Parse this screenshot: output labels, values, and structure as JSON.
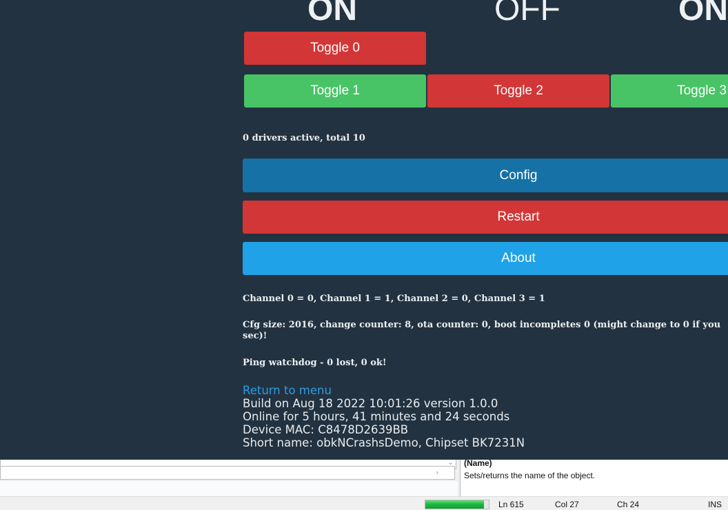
{
  "states": [
    "ON",
    "OFF",
    "ON"
  ],
  "toggles": {
    "t0": "Toggle 0",
    "t1": "Toggle 1",
    "t2": "Toggle 2",
    "t3": "Toggle 3"
  },
  "drivers_status": "0 drivers active, total 10",
  "buttons": {
    "config": "Config",
    "restart": "Restart",
    "about": "About"
  },
  "channels": "Channel 0 = 0, Channel 1 = 1, Channel 2 = 0, Channel 3 = 1",
  "cfg_line1": "Cfg size: 2016, change counter: 8, ota counter: 0, boot incompletes 0 (might change to 0 if you",
  "cfg_line2": "sec)!",
  "watchdog": "Ping watchdog - 0 lost, 0 ok!",
  "return_link": "Return to menu",
  "build": "Build on Aug 18 2022 10:01:26 version 1.0.0",
  "online": "Online for 5 hours, 41 minutes and 24 seconds",
  "mac": "Device MAC: C8478D2639BB",
  "short_name": "Short name: obkNCrashsDemo, Chipset BK7231N",
  "property": {
    "name": "(Name)",
    "description": "Sets/returns the name of the object."
  },
  "status": {
    "progress_percent": 92,
    "ln": "Ln 615",
    "col": "Col 27",
    "ch": "Ch 24",
    "mode": "INS"
  },
  "colors": {
    "page_bg": "#233240",
    "red": "#d33636",
    "green": "#48c466",
    "config_blue": "#1571a6",
    "about_blue": "#1fa2e8",
    "link": "#2a9de6"
  }
}
